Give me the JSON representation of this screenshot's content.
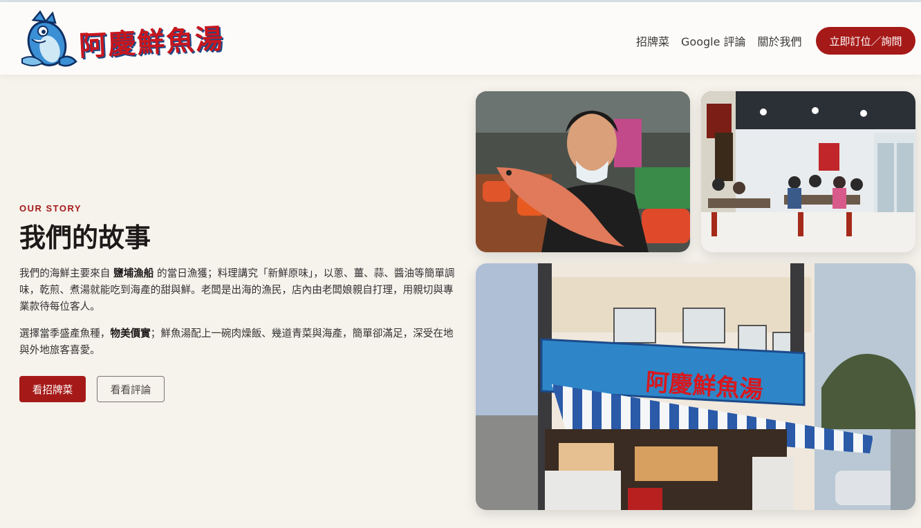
{
  "brand": {
    "name": "阿慶鮮魚湯"
  },
  "nav": {
    "links": [
      "招牌菜",
      "Google 評論",
      "關於我們"
    ],
    "cta": "立即訂位／詢問"
  },
  "story": {
    "eyebrow": "OUR STORY",
    "title": "我們的故事",
    "p1_a": "我們的海鮮主要來自 ",
    "p1_bold": "鹽埔漁船",
    "p1_b": " 的當日漁獲；料理講究「新鮮原味」，以蔥、薑、蒜、醬油等簡單調味，乾煎、煮湯就能吃到海產的甜與鮮。老闆是出海的漁民，店內由老闆娘親自打理，用親切與專業款待每位客人。",
    "p2_a": "選擇當季盛產魚種，",
    "p2_bold": "物美價實",
    "p2_b": "；鮮魚湯配上一碗肉燥飯、幾道青菜與海產，簡單卻滿足，深受在地與外地旅客喜愛。",
    "btn_primary": "看招牌菜",
    "btn_outline": "看看評論"
  },
  "photos": {
    "storefront_sign": "阿慶鮮魚湯"
  },
  "colors": {
    "accent": "#a51a18",
    "background": "#f6f2ec",
    "navbar": "#fdfbf9"
  },
  "icons": {
    "logo": "fish-mascot-icon"
  }
}
